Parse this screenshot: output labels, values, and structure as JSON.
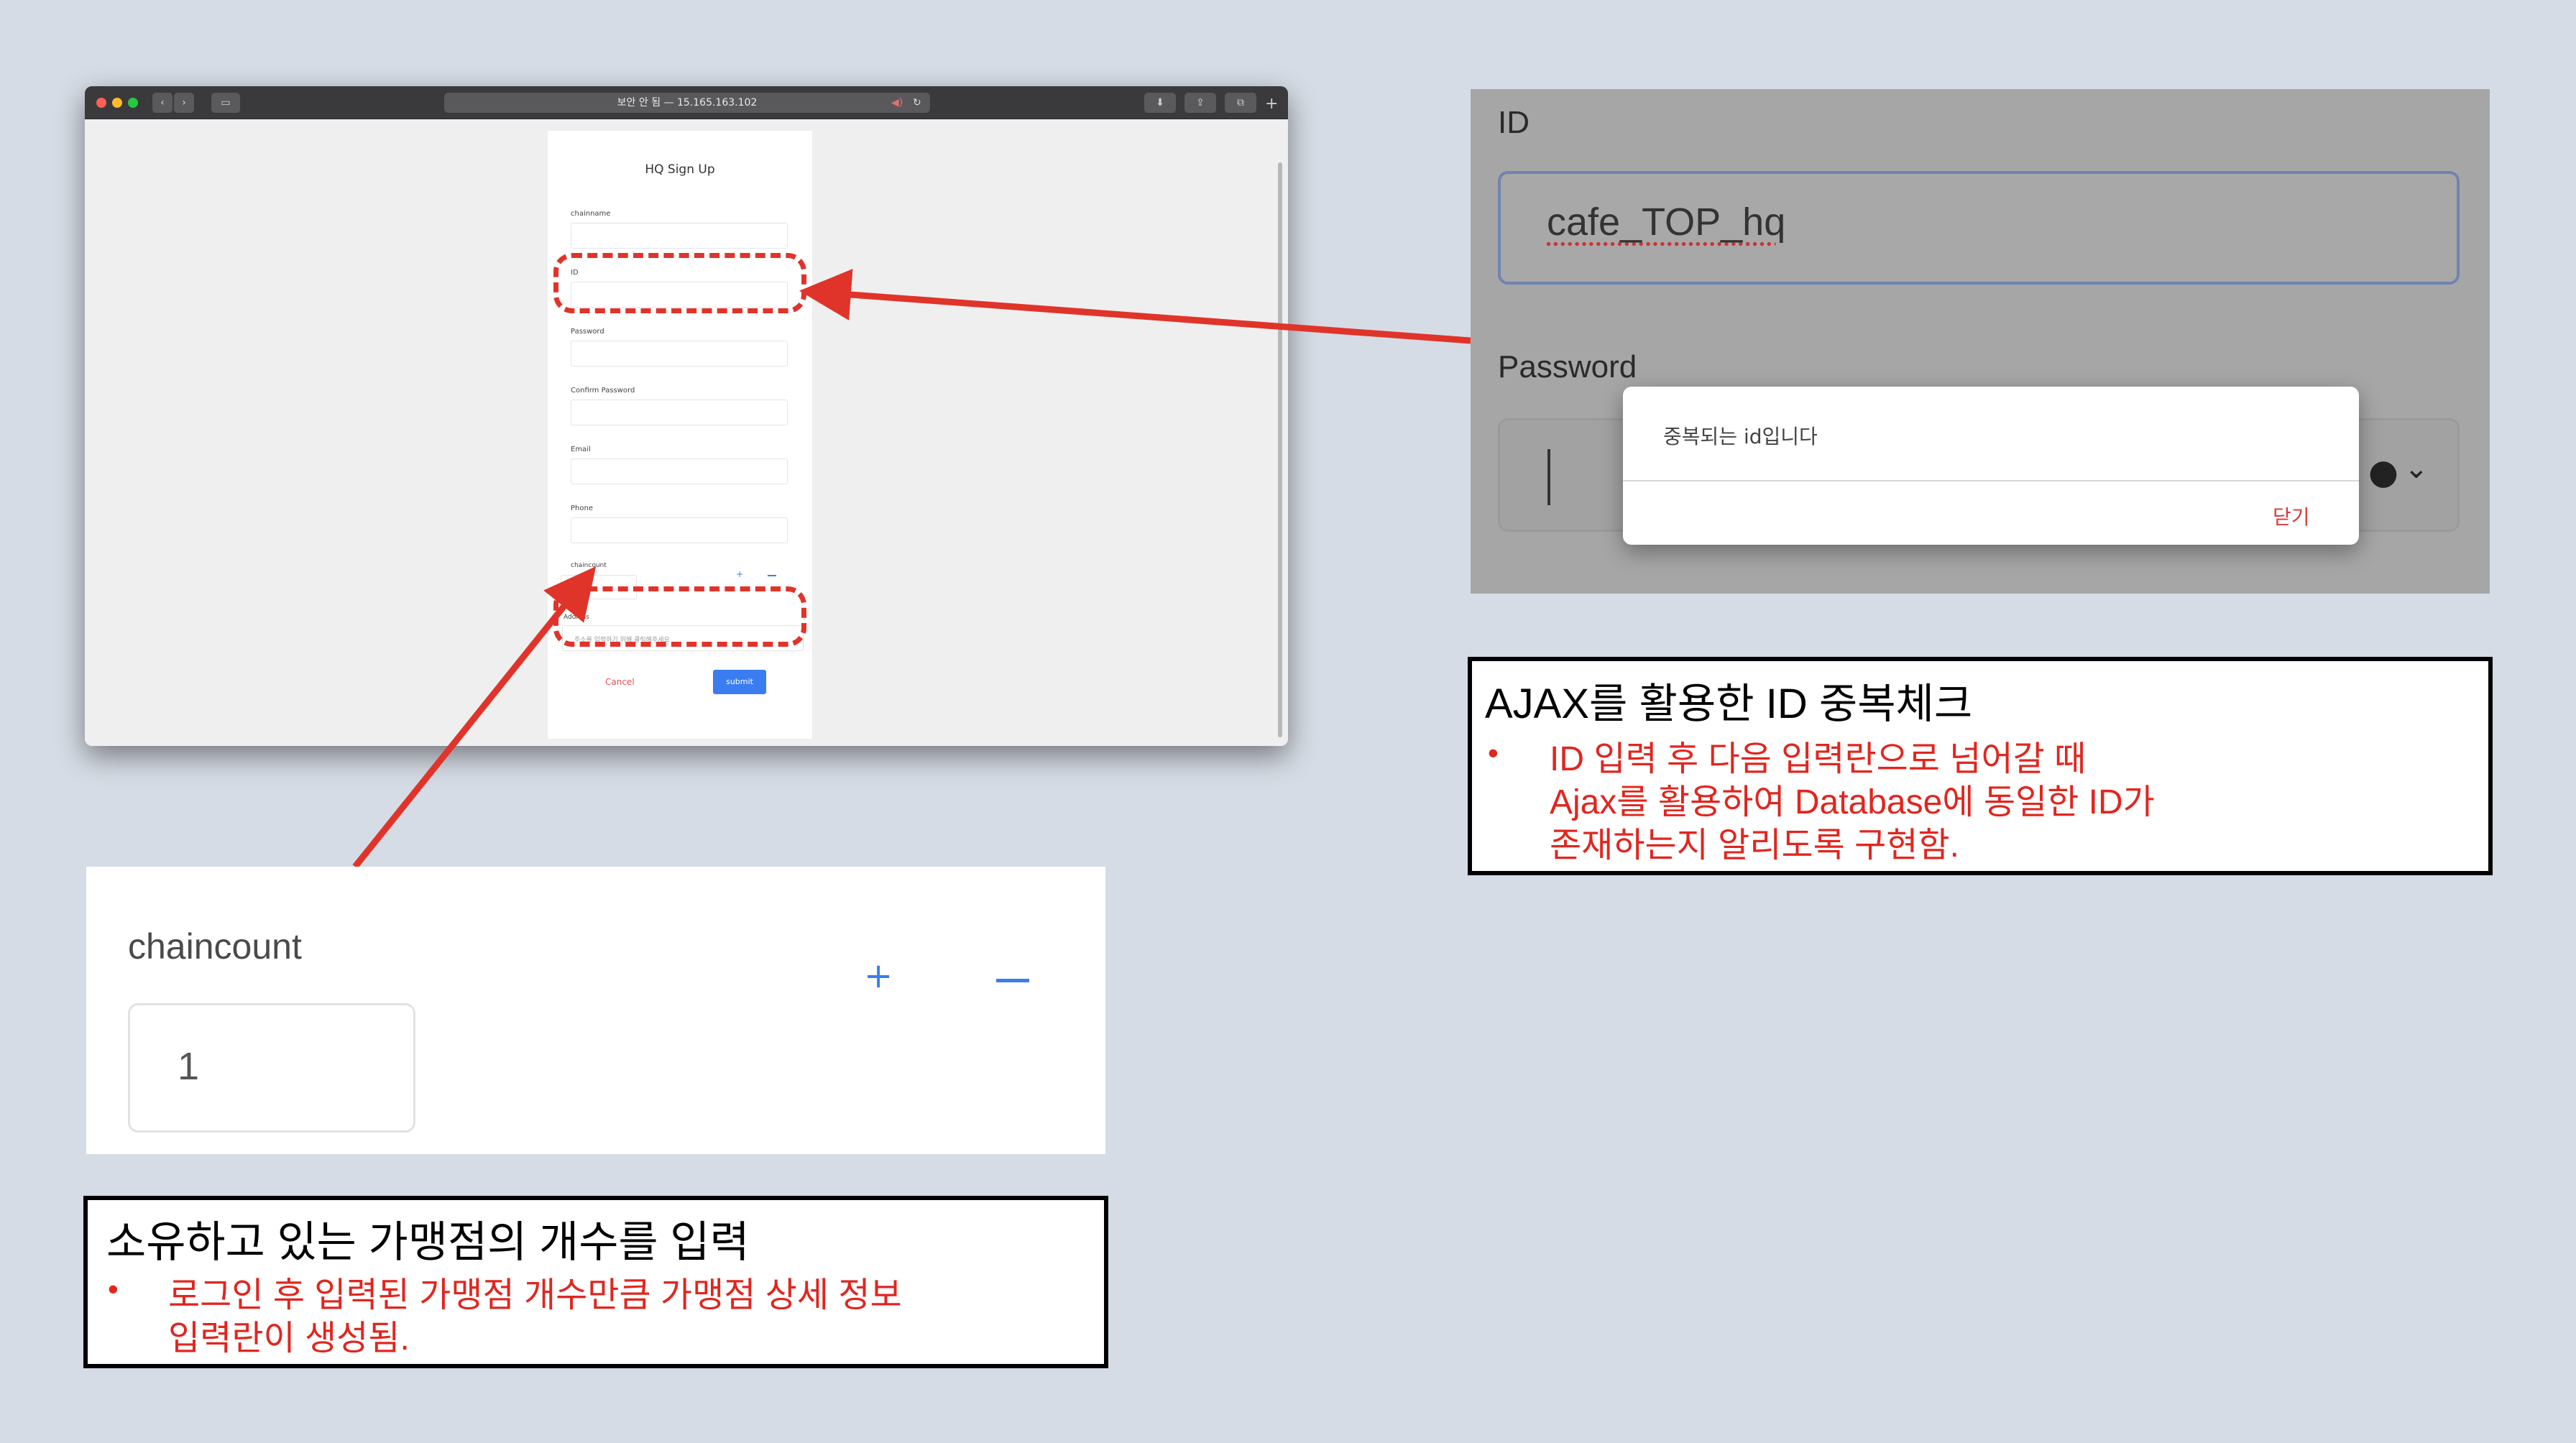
{
  "browser": {
    "url": "보안 안 됨 — 15.165.163.102",
    "form": {
      "title": "HQ Sign Up",
      "fields": [
        {
          "label": "chainname"
        },
        {
          "label": "ID"
        },
        {
          "label": "Password"
        },
        {
          "label": "Confirm Password"
        },
        {
          "label": "Email"
        },
        {
          "label": "Phone"
        }
      ],
      "chaincount_label": "chaincount",
      "chaincount_value": "1",
      "address_label": "Address",
      "address_placeholder": "주소를 입력하기 위해 클릭해주세요",
      "cancel_label": "Cancel",
      "submit_label": "submit"
    }
  },
  "id_panel": {
    "id_label": "ID",
    "id_value": "cafe_TOP_hq",
    "password_label": "Password",
    "dialog_message": "중복되는 id입니다",
    "dialog_close": "닫기"
  },
  "chaincount_panel": {
    "label": "chaincount",
    "value": "1",
    "plus": "+"
  },
  "caption_id": {
    "title": "AJAX를 활용한 ID 중복체크",
    "bullet_marker": "•",
    "lines": [
      "ID 입력 후 다음 입력란으로 넘어갈 때",
      "Ajax를 활용하여 Database에 동일한 ID가",
      "존재하는지 알리도록 구현함."
    ]
  },
  "caption_count": {
    "title": "소유하고 있는 가맹점의 개수를 입력",
    "bullet_marker": "•",
    "lines": [
      "로그인 후 입력된 가맹점 개수만큼 가맹점 상세 정보",
      "입력란이 생성됨."
    ]
  },
  "colors": {
    "background": "#d6dce5",
    "accent_red": "#e0261f",
    "button_blue": "#3a7df0"
  }
}
